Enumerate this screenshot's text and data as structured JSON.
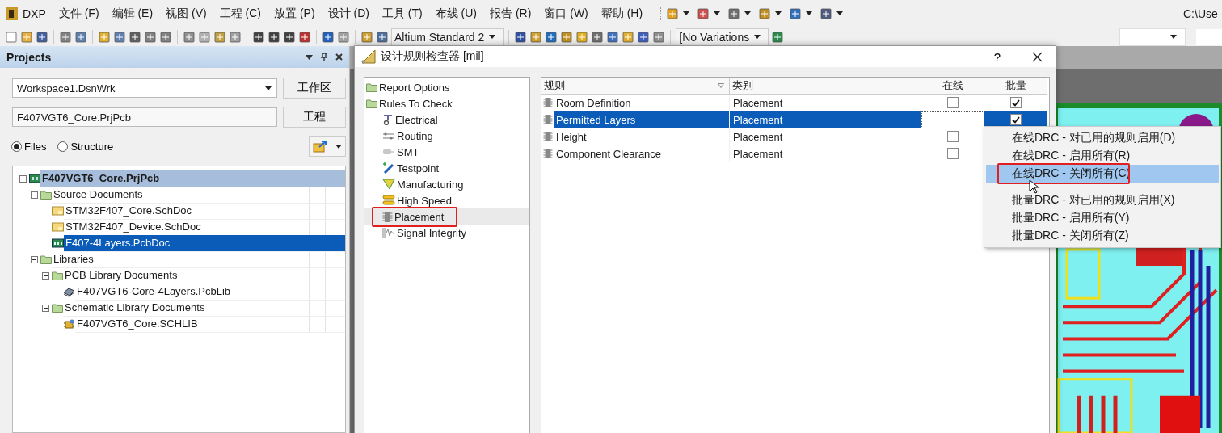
{
  "menu_bar": {
    "items": [
      "DXP",
      "文件 (F)",
      "编辑 (E)",
      "视图 (V)",
      "工程 (C)",
      "放置 (P)",
      "设计 (D)",
      "工具 (T)",
      "布线 (U)",
      "报告 (R)",
      "窗口 (W)",
      "帮助 (H)"
    ]
  },
  "path_text": "C:\\Use",
  "toolbar": {
    "standard_combo": "Altium Standard 2",
    "variations_combo": "[No Variations"
  },
  "projects_panel": {
    "title": "Projects",
    "workspace": "Workspace1.DsnWrk",
    "workspace_button": "工作区",
    "project": "F407VGT6_Core.PrjPcb",
    "project_button": "工程",
    "view_options": [
      {
        "label": "Files",
        "selected": true
      },
      {
        "label": "Structure",
        "selected": false
      }
    ],
    "tree": [
      {
        "label": "F407VGT6_Core.PrjPcb",
        "kind": "project",
        "selected": false,
        "highlighted": true,
        "expanded": true,
        "children": [
          {
            "label": "Source Documents",
            "kind": "folder",
            "selected": false,
            "expanded": true,
            "children": [
              {
                "label": "STM32F407_Core.SchDoc",
                "kind": "schdoc",
                "selected": false
              },
              {
                "label": "STM32F407_Device.SchDoc",
                "kind": "schdoc",
                "selected": false
              },
              {
                "label": "F407-4Layers.PcbDoc",
                "kind": "pcbdoc",
                "selected": true
              }
            ]
          },
          {
            "label": "Libraries",
            "kind": "folder",
            "selected": false,
            "expanded": true,
            "children": [
              {
                "label": "PCB Library Documents",
                "kind": "folder",
                "selected": false,
                "expanded": true,
                "children": [
                  {
                    "label": "F407VGT6-Core-4Layers.PcbLib",
                    "kind": "pcblib",
                    "selected": false
                  }
                ]
              },
              {
                "label": "Schematic Library Documents",
                "kind": "folder",
                "selected": false,
                "expanded": true,
                "children": [
                  {
                    "label": "F407VGT6_Core.SCHLIB",
                    "kind": "schlib",
                    "selected": false
                  }
                ]
              }
            ]
          }
        ]
      }
    ]
  },
  "dialog": {
    "title": "设计规则检查器 [mil]",
    "help": "?",
    "tree": [
      {
        "label": "Report Options",
        "kind": "folder",
        "selected": false
      },
      {
        "label": "Rules To Check",
        "kind": "folder",
        "selected": false,
        "children": [
          {
            "label": "Electrical",
            "kind": "electrical",
            "selected": false
          },
          {
            "label": "Routing",
            "kind": "routing",
            "selected": false
          },
          {
            "label": "SMT",
            "kind": "smt",
            "selected": false
          },
          {
            "label": "Testpoint",
            "kind": "testpoint",
            "selected": false
          },
          {
            "label": "Manufacturing",
            "kind": "manufacturing",
            "selected": false
          },
          {
            "label": "High Speed",
            "kind": "highspeed",
            "selected": false
          },
          {
            "label": "Placement",
            "kind": "placement",
            "selected": true,
            "marked": true
          },
          {
            "label": "Signal Integrity",
            "kind": "signal",
            "selected": false
          }
        ]
      }
    ],
    "table": {
      "columns": [
        "规则",
        "类别",
        "在线",
        "批量"
      ],
      "rows": [
        {
          "rule": "Room Definition",
          "category": "Placement",
          "online": false,
          "batch": true,
          "selected": false
        },
        {
          "rule": "Permitted Layers",
          "category": "Placement",
          "editing": true,
          "batch": true,
          "selected": true
        },
        {
          "rule": "Height",
          "category": "Placement",
          "online": false,
          "selected": false
        },
        {
          "rule": "Component Clearance",
          "category": "Placement",
          "online": false,
          "selected": false
        }
      ]
    }
  },
  "context_menu": {
    "items": [
      {
        "kind": "item",
        "label": "在线DRC - 对已用的规则启用(D)",
        "selected": false
      },
      {
        "kind": "item",
        "label": "在线DRC - 启用所有(R)",
        "selected": false
      },
      {
        "kind": "item",
        "label": "在线DRC - 关闭所有(C)",
        "selected": true,
        "marked": true
      },
      {
        "kind": "separator"
      },
      {
        "kind": "item",
        "label": "批量DRC - 对已用的规则启用(X)",
        "selected": false
      },
      {
        "kind": "item",
        "label": "批量DRC - 启用所有(Y)",
        "selected": false
      },
      {
        "kind": "item",
        "label": "批量DRC - 关闭所有(Z)",
        "selected": false
      }
    ]
  }
}
